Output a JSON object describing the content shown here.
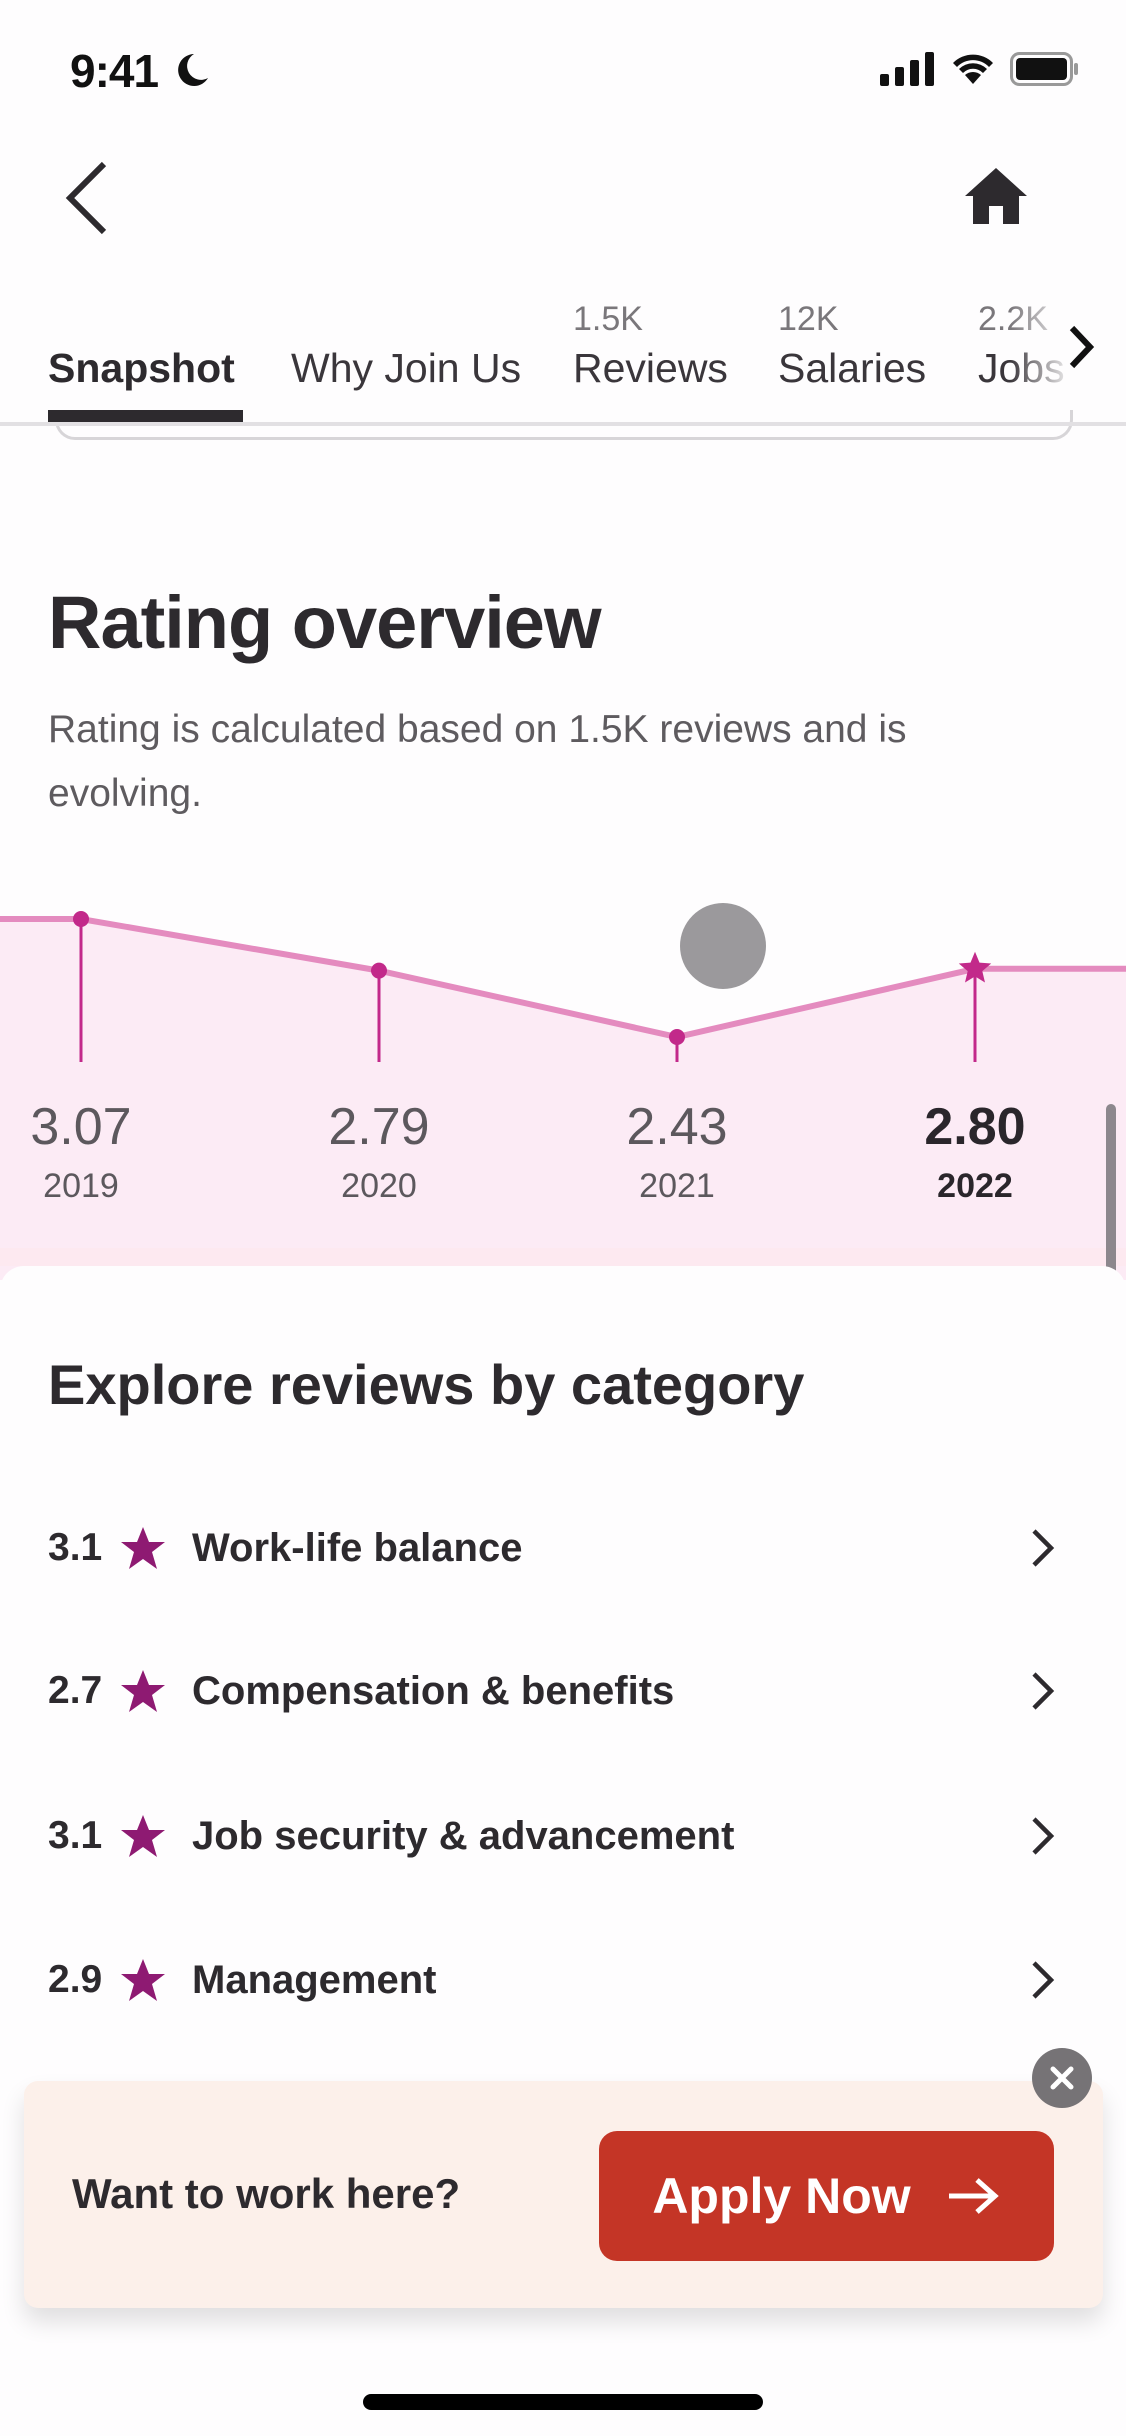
{
  "status_bar": {
    "time": "9:41"
  },
  "nav": {
    "back_icon": "chevron-left-icon",
    "home_icon": "home-icon"
  },
  "tabs": [
    {
      "label": "Snapshot",
      "count": "",
      "active": true
    },
    {
      "label": "Why Join Us",
      "count": ""
    },
    {
      "label": "Reviews",
      "count": "1.5K"
    },
    {
      "label": "Salaries",
      "count": "12K"
    },
    {
      "label": "Jobs",
      "count": "2.2K"
    }
  ],
  "rating_overview": {
    "title": "Rating overview",
    "subtitle": "Rating is calculated based on 1.5K reviews and is evolving."
  },
  "chart_data": {
    "type": "line",
    "title": "Rating overview",
    "x": [
      "2019",
      "2020",
      "2021",
      "2022"
    ],
    "values": [
      3.07,
      2.79,
      2.43,
      2.8
    ],
    "value_labels": [
      "3.07",
      "2.79",
      "2.43",
      "2.80"
    ],
    "highlighted": "2022",
    "colors": {
      "line": "#e48bbf",
      "marker": "#c2298a",
      "area": "#fcebf5"
    }
  },
  "categories": {
    "title": "Explore reviews by category",
    "items": [
      {
        "score": "3.1",
        "label": "Work-life balance"
      },
      {
        "score": "2.7",
        "label": "Compensation & benefits"
      },
      {
        "score": "3.1",
        "label": "Job security & advancement"
      },
      {
        "score": "2.9",
        "label": "Management"
      }
    ],
    "star_color": "#8e1a72"
  },
  "banner": {
    "text": "Want to work here?",
    "button_label": "Apply Now",
    "button_color": "#c43526"
  }
}
